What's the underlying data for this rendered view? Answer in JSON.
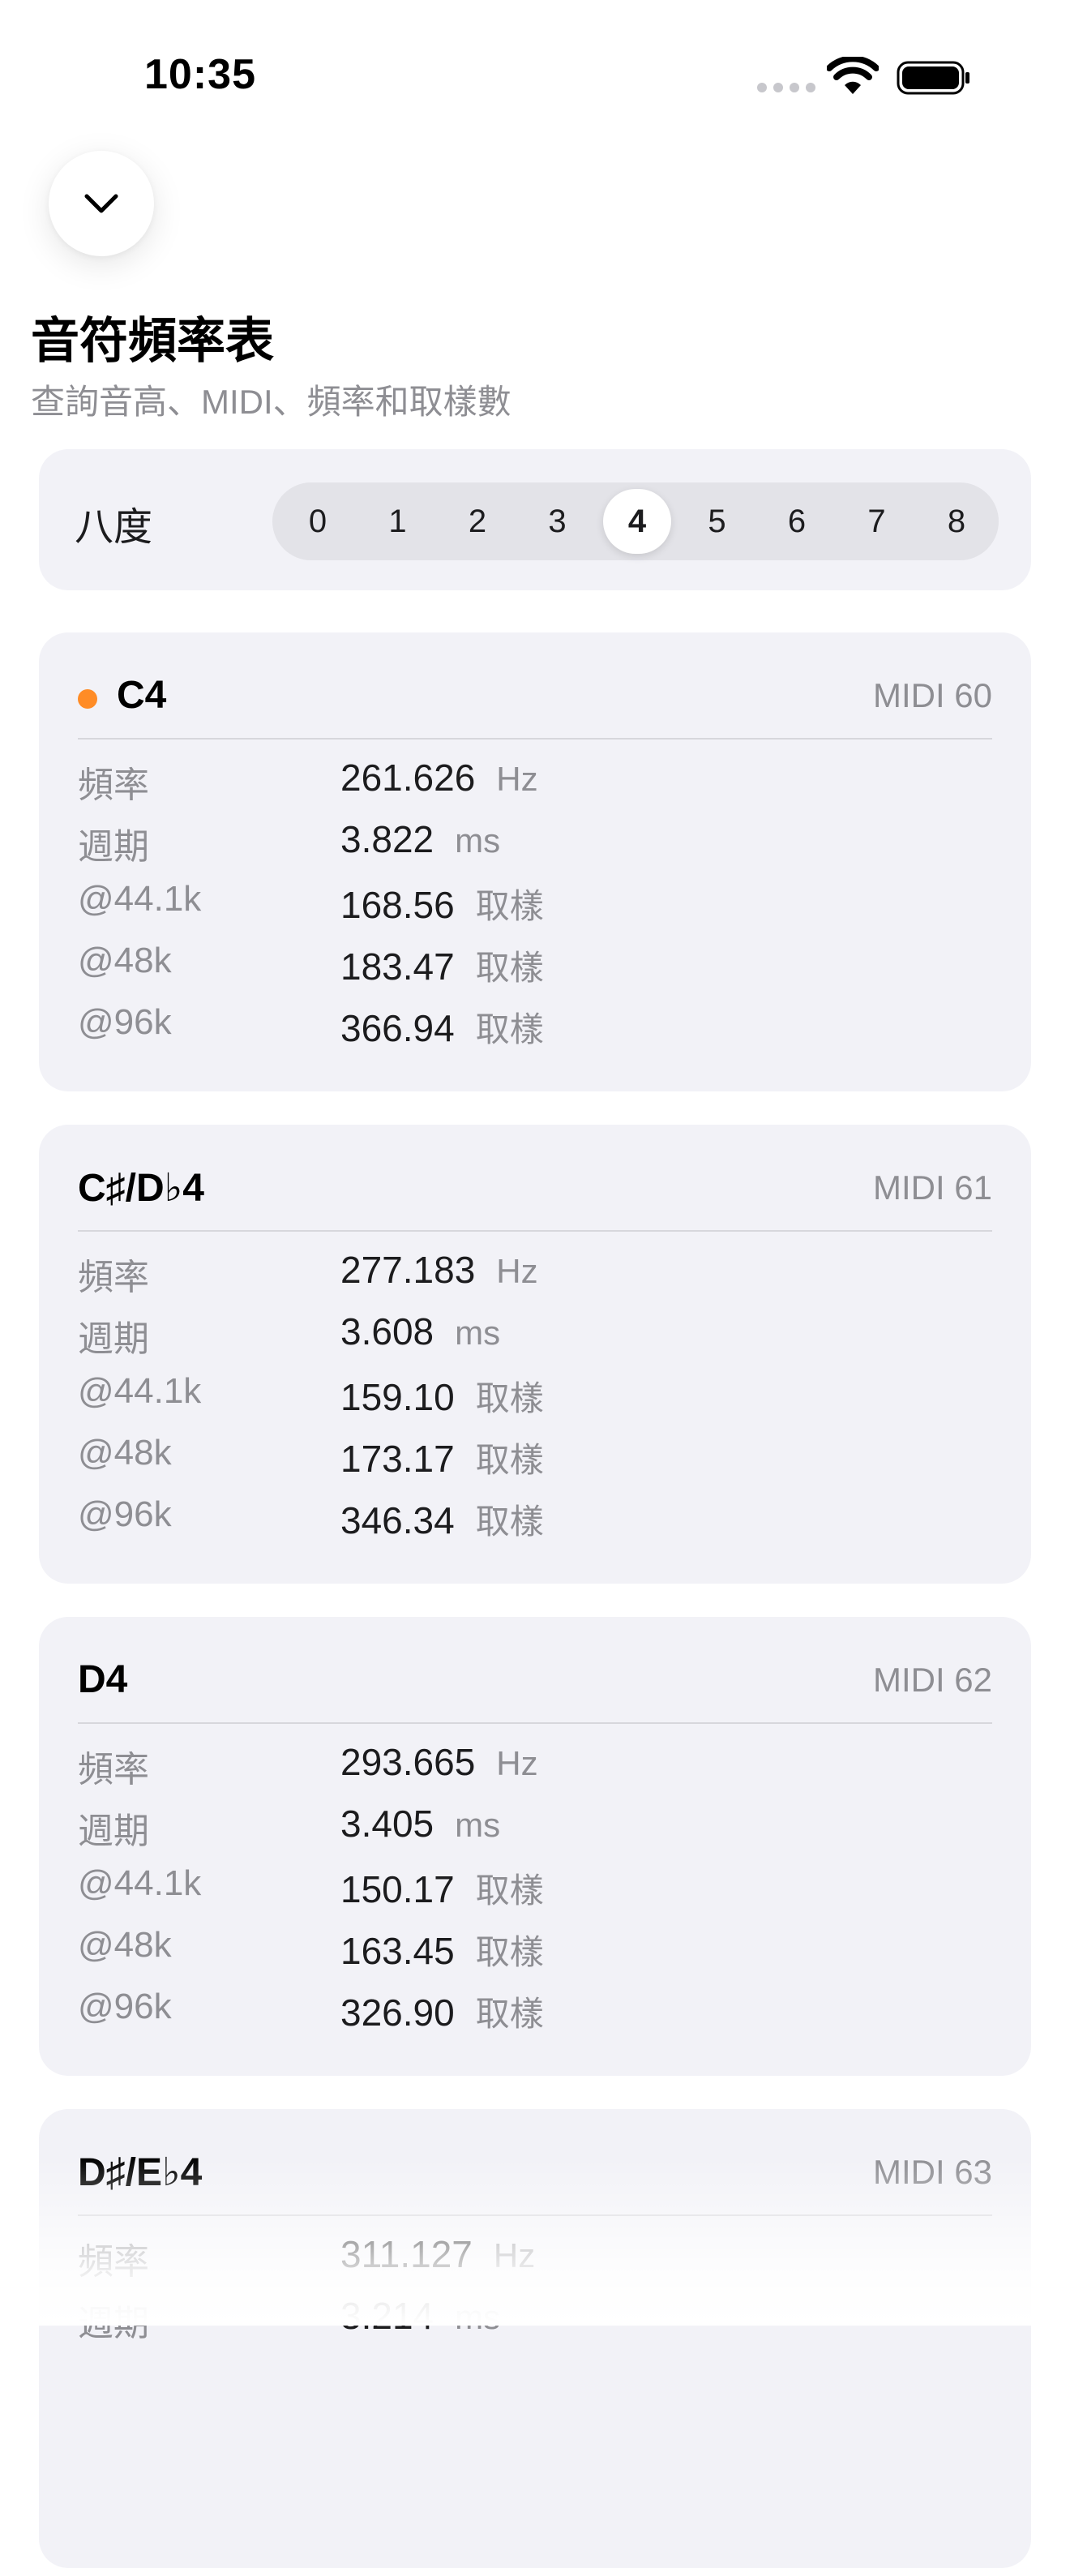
{
  "status_bar": {
    "time": "10:35"
  },
  "header": {
    "title": "音符頻率表",
    "subtitle": "查詢音高、MIDI、頻率和取樣數"
  },
  "octave_picker": {
    "label": "八度",
    "options": [
      "0",
      "1",
      "2",
      "3",
      "4",
      "5",
      "6",
      "7",
      "8"
    ],
    "selected": "4"
  },
  "notes": [
    {
      "name": "C4",
      "midi": "MIDI 60",
      "highlighted": true,
      "rows": [
        {
          "label": "頻率",
          "value": "261.626",
          "unit": "Hz"
        },
        {
          "label": "週期",
          "value": "3.822",
          "unit": "ms"
        },
        {
          "label": "@44.1k",
          "value": "168.56",
          "unit": "取樣"
        },
        {
          "label": "@48k",
          "value": "183.47",
          "unit": "取樣"
        },
        {
          "label": "@96k",
          "value": "366.94",
          "unit": "取樣"
        }
      ]
    },
    {
      "name": "C♯/D♭4",
      "midi": "MIDI 61",
      "highlighted": false,
      "rows": [
        {
          "label": "頻率",
          "value": "277.183",
          "unit": "Hz"
        },
        {
          "label": "週期",
          "value": "3.608",
          "unit": "ms"
        },
        {
          "label": "@44.1k",
          "value": "159.10",
          "unit": "取樣"
        },
        {
          "label": "@48k",
          "value": "173.17",
          "unit": "取樣"
        },
        {
          "label": "@96k",
          "value": "346.34",
          "unit": "取樣"
        }
      ]
    },
    {
      "name": "D4",
      "midi": "MIDI 62",
      "highlighted": false,
      "rows": [
        {
          "label": "頻率",
          "value": "293.665",
          "unit": "Hz"
        },
        {
          "label": "週期",
          "value": "3.405",
          "unit": "ms"
        },
        {
          "label": "@44.1k",
          "value": "150.17",
          "unit": "取樣"
        },
        {
          "label": "@48k",
          "value": "163.45",
          "unit": "取樣"
        },
        {
          "label": "@96k",
          "value": "326.90",
          "unit": "取樣"
        }
      ]
    },
    {
      "name": "D♯/E♭4",
      "midi": "MIDI 63",
      "highlighted": false,
      "rows": [
        {
          "label": "頻率",
          "value": "311.127",
          "unit": "Hz"
        },
        {
          "label": "週期",
          "value": "3.214",
          "unit": "ms"
        }
      ]
    }
  ],
  "colors": {
    "accent_dot": "#ff8c26",
    "card_bg": "#f2f2f7",
    "secondary_text": "#8e8e93"
  }
}
